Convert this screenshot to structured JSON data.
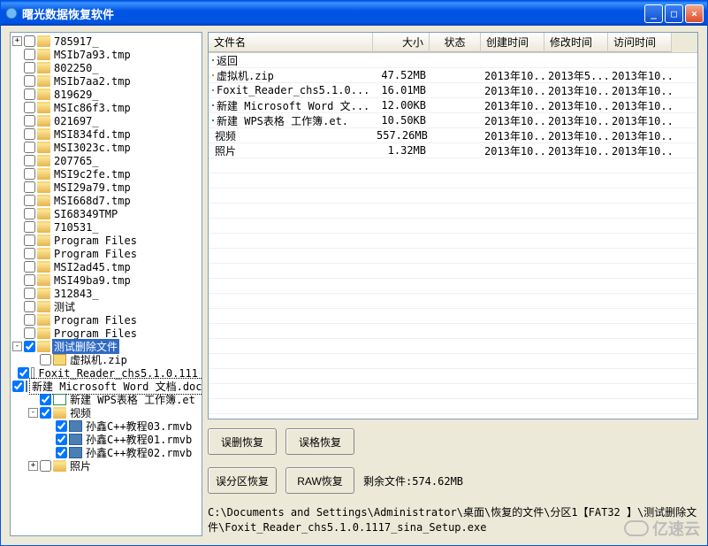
{
  "window": {
    "title": "曙光数据恢复软件",
    "min_label": "_",
    "max_label": "□",
    "close_label": "×"
  },
  "tree": {
    "items": [
      {
        "level": 0,
        "exp": "+",
        "check": false,
        "icon": "folder",
        "label": "785917_"
      },
      {
        "level": 0,
        "exp": "",
        "check": false,
        "icon": "folder",
        "label": "MSIb7a93.tmp"
      },
      {
        "level": 0,
        "exp": "",
        "check": false,
        "icon": "folder",
        "label": "802250_"
      },
      {
        "level": 0,
        "exp": "",
        "check": false,
        "icon": "folder",
        "label": "MSIb7aa2.tmp"
      },
      {
        "level": 0,
        "exp": "",
        "check": false,
        "icon": "folder",
        "label": "819629_"
      },
      {
        "level": 0,
        "exp": "",
        "check": false,
        "icon": "folder",
        "label": "MSIc86f3.tmp"
      },
      {
        "level": 0,
        "exp": "",
        "check": false,
        "icon": "folder",
        "label": "021697_"
      },
      {
        "level": 0,
        "exp": "",
        "check": false,
        "icon": "folder",
        "label": "MSI834fd.tmp"
      },
      {
        "level": 0,
        "exp": "",
        "check": false,
        "icon": "folder",
        "label": "MSI3023c.tmp"
      },
      {
        "level": 0,
        "exp": "",
        "check": false,
        "icon": "folder",
        "label": "207765_"
      },
      {
        "level": 0,
        "exp": "",
        "check": false,
        "icon": "folder",
        "label": "MSI9c2fe.tmp"
      },
      {
        "level": 0,
        "exp": "",
        "check": false,
        "icon": "folder",
        "label": "MSI29a79.tmp"
      },
      {
        "level": 0,
        "exp": "",
        "check": false,
        "icon": "folder",
        "label": "MSI668d7.tmp"
      },
      {
        "level": 0,
        "exp": "",
        "check": false,
        "icon": "folder",
        "label": "SI68349TMP"
      },
      {
        "level": 0,
        "exp": "",
        "check": false,
        "icon": "folder",
        "label": "710531_"
      },
      {
        "level": 0,
        "exp": "",
        "check": false,
        "icon": "folder",
        "label": "Program Files"
      },
      {
        "level": 0,
        "exp": "",
        "check": false,
        "icon": "folder",
        "label": "Program Files"
      },
      {
        "level": 0,
        "exp": "",
        "check": false,
        "icon": "folder",
        "label": "MSI2ad45.tmp"
      },
      {
        "level": 0,
        "exp": "",
        "check": false,
        "icon": "folder",
        "label": "MSI49ba9.tmp"
      },
      {
        "level": 0,
        "exp": "",
        "check": false,
        "icon": "folder",
        "label": "312843_"
      },
      {
        "level": 0,
        "exp": "",
        "check": false,
        "icon": "folder",
        "label": "测试"
      },
      {
        "level": 0,
        "exp": "",
        "check": false,
        "icon": "folder",
        "label": "Program Files"
      },
      {
        "level": 0,
        "exp": "",
        "check": false,
        "icon": "folder",
        "label": "Program Files"
      },
      {
        "level": 0,
        "exp": "-",
        "check": true,
        "icon": "folder",
        "label": "测试删除文件",
        "sel": true
      },
      {
        "level": 1,
        "exp": "",
        "check": false,
        "icon": "zip",
        "label": "虚拟机.zip"
      },
      {
        "level": 1,
        "exp": "",
        "check": true,
        "icon": "file",
        "label": "Foxit_Reader_chs5.1.0.111"
      },
      {
        "level": 1,
        "exp": "",
        "check": true,
        "icon": "word",
        "label": "新建 Microsoft Word 文档.doc",
        "box": true
      },
      {
        "level": 1,
        "exp": "",
        "check": true,
        "icon": "et",
        "label": "新建 WPS表格 工作簿.et"
      },
      {
        "level": 1,
        "exp": "-",
        "check": true,
        "icon": "folder",
        "label": "视频"
      },
      {
        "level": 2,
        "exp": "",
        "check": true,
        "icon": "video",
        "label": "孙鑫C++教程03.rmvb"
      },
      {
        "level": 2,
        "exp": "",
        "check": true,
        "icon": "video",
        "label": "孙鑫C++教程01.rmvb"
      },
      {
        "level": 2,
        "exp": "",
        "check": true,
        "icon": "video",
        "label": "孙鑫C++教程02.rmvb"
      },
      {
        "level": 1,
        "exp": "+",
        "check": false,
        "icon": "folder",
        "label": "照片"
      }
    ]
  },
  "listview": {
    "columns": {
      "name": "文件名",
      "size": "大小",
      "status": "状态",
      "ctime": "创建时间",
      "mtime": "修改时间",
      "atime": "访问时间"
    },
    "rows": [
      {
        "icon": "up",
        "name": "返回",
        "size": "",
        "status": "",
        "ctime": "",
        "mtime": "",
        "atime": ""
      },
      {
        "icon": "zip",
        "name": "虚拟机.zip",
        "size": "47.52MB",
        "status": "",
        "ctime": "2013年10...",
        "mtime": "2013年5...",
        "atime": "2013年10..."
      },
      {
        "icon": "file",
        "name": "Foxit_Reader_chs5.1.0...",
        "size": "16.01MB",
        "status": "",
        "ctime": "2013年10...",
        "mtime": "2013年10...",
        "atime": "2013年10..."
      },
      {
        "icon": "word",
        "name": "新建 Microsoft Word 文...",
        "size": "12.00KB",
        "status": "",
        "ctime": "2013年10...",
        "mtime": "2013年10...",
        "atime": "2013年10..."
      },
      {
        "icon": "et",
        "name": "新建 WPS表格 工作簿.et.",
        "size": "10.50KB",
        "status": "",
        "ctime": "2013年10...",
        "mtime": "2013年10...",
        "atime": "2013年10..."
      },
      {
        "icon": "folder",
        "name": "视频",
        "size": "557.26MB",
        "status": "",
        "ctime": "2013年10...",
        "mtime": "2013年10...",
        "atime": "2013年10..."
      },
      {
        "icon": "folder",
        "name": "照片",
        "size": "1.32MB",
        "status": "",
        "ctime": "2013年10...",
        "mtime": "2013年10...",
        "atime": "2013年10..."
      }
    ]
  },
  "buttons": {
    "b1": "误删恢复",
    "b2": "误格恢复",
    "b3": "误分区恢复",
    "b4": "RAW恢复"
  },
  "status": {
    "remaining": "剩余文件:574.62MB",
    "path": "C:\\Documents and Settings\\Administrator\\桌面\\恢复的文件\\分区1【FAT32 】\\测试删除文件\\Foxit_Reader_chs5.1.0.1117_sina_Setup.exe"
  },
  "watermark": "亿速云"
}
